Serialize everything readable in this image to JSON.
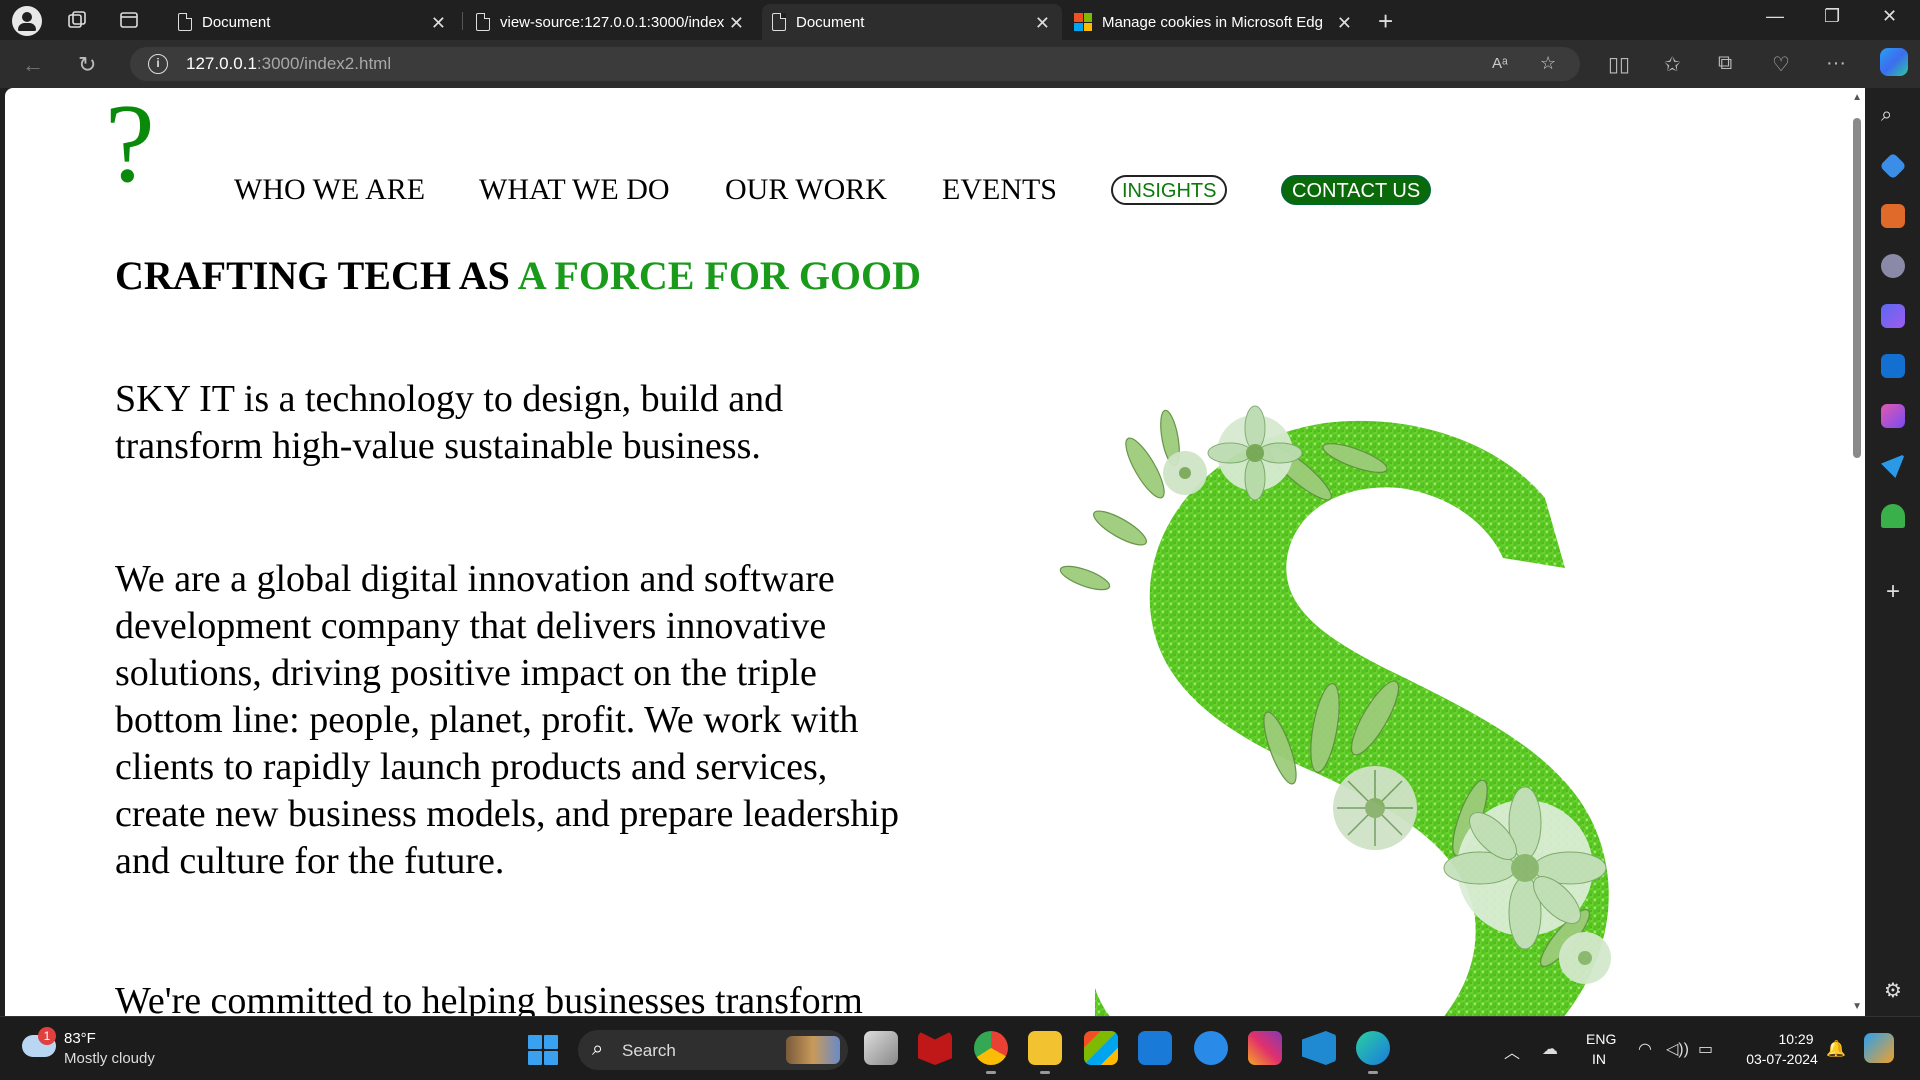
{
  "browser": {
    "tabs": [
      {
        "title": "Document",
        "active": false,
        "icon": "document-icon"
      },
      {
        "title": "view-source:127.0.0.1:3000/index",
        "active": false,
        "icon": "document-icon"
      },
      {
        "title": "Document",
        "active": true,
        "icon": "document-icon"
      },
      {
        "title": "Manage cookies in Microsoft Edg",
        "active": false,
        "icon": "microsoft-logo-icon"
      }
    ],
    "url_host": "127.0.0.1",
    "url_path": ":3000/index2.html"
  },
  "page": {
    "logo": "?",
    "nav": {
      "who_we_are": "WHO WE ARE",
      "what_we_do": "WHAT WE DO",
      "our_work": "OUR WORK",
      "events": "EVENTS",
      "insights": "INSIGHTS",
      "contact_us": "CONTACT US"
    },
    "headline_part1": "CRAFTING TECH AS ",
    "headline_part2": "A FORCE FOR GOOD",
    "paragraph1": "SKY IT is a technology to design, build and transform high-value sustainable business.",
    "paragraph2": "We are a global digital innovation and software development company that delivers innovative solutions, driving positive impact on the triple bottom line: people, planet, profit. We work with clients to rapidly launch products and services, create new business models, and prepare leadership and culture for the future.",
    "paragraph3": "We're committed to helping businesses transform",
    "colors": {
      "accent": "#1a9a1a",
      "logo": "#0a8a0a",
      "contact_bg": "#0a6a0a"
    }
  },
  "taskbar": {
    "weather_badge": "1",
    "temperature": "83°F",
    "weather": "Mostly cloudy",
    "search_label": "Search",
    "lang_top": "ENG",
    "lang_bottom": "IN",
    "time": "10:29",
    "date": "03-07-2024"
  }
}
